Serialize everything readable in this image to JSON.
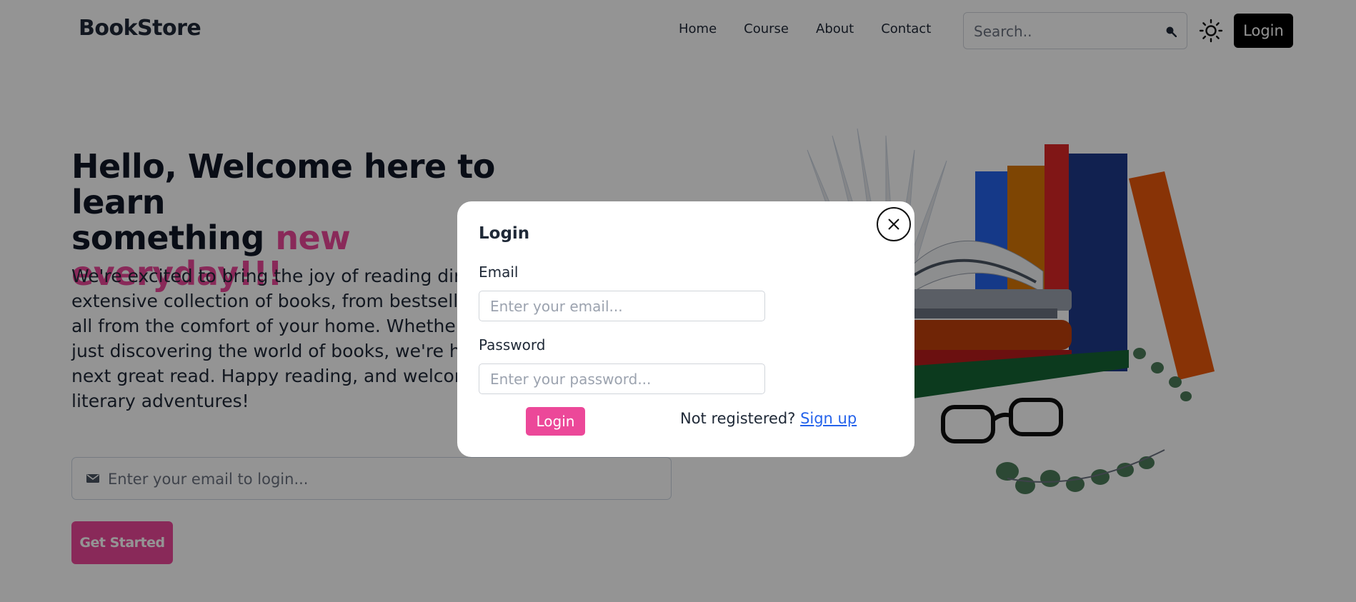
{
  "navbar": {
    "brand": "BookStore",
    "links": [
      "Home",
      "Course",
      "About",
      "Contact"
    ],
    "search_placeholder": "Search..",
    "login_label": "Login"
  },
  "hero": {
    "title_line1": "Hello, Welcome here to learn",
    "title_line2_prefix": "something ",
    "title_line2_accent": "new everyday!!!",
    "description": "We're excited to bring the joy of reading directly to you. Explore our extensive collection of books, from bestsellers to timeless classics, all from the comfort of your home. Whether you're an avid reader or just discovering the world of books, we're here to help you find your next great read. Happy reading, and welcome to a world of endless literary adventures!",
    "email_placeholder": "Enter your email to login...",
    "cta_label": "Get Started"
  },
  "modal": {
    "title": "Login",
    "email_label": "Email",
    "email_placeholder": "Enter your email...",
    "password_label": "Password",
    "password_placeholder": "Enter your password...",
    "login_label": "Login",
    "not_registered": "Not registered? ",
    "signup_label": "Sign up",
    "close_icon": "close-icon"
  },
  "colors": {
    "accent": "#ec4899",
    "overlay": "rgba(0,0,0,0.42)",
    "link": "#2563eb",
    "dark_button": "#000000"
  }
}
